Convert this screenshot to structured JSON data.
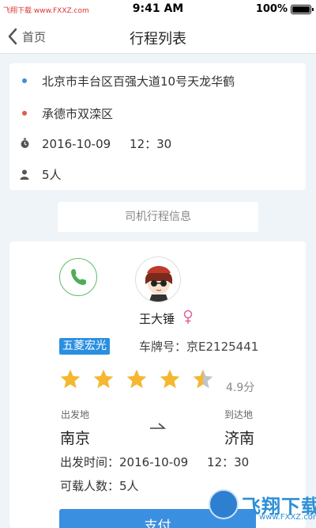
{
  "status_bar": {
    "watermark": "飞翔下载 www.FXXZ.com",
    "time": "9:41 AM",
    "battery_text": "100%"
  },
  "nav": {
    "back_label": "首页",
    "title": "行程列表"
  },
  "route": {
    "start_address": "北京市丰台区百强大道10号天龙华鹤",
    "end_address": "承德市双滦区",
    "date": "2016-10-09",
    "time": "12：30",
    "passengers": "5人",
    "start_color": "#3b8fe0",
    "end_color": "#e35a4f"
  },
  "driver_tab": "司机行程信息",
  "driver": {
    "name": "王大锤",
    "car_model": "五菱宏光",
    "plate_label": "车牌号：",
    "plate": "京E2125441",
    "rating_value": 4.9,
    "rating_text": "4.9分",
    "star_color": "#f5b72f"
  },
  "trip": {
    "departure_label": "出发地",
    "arrival_label": "到达地",
    "departure_city": "南京",
    "arrival_city": "济南",
    "departure_time_label": "出发时间：",
    "departure_date": "2016-10-09",
    "departure_time": "12：30",
    "seats_label": "可载人数：",
    "seats": "5人"
  },
  "pay_button": "支付",
  "footer_watermark": {
    "text": "飞翔下载",
    "url": "www.FXXZ.com"
  }
}
